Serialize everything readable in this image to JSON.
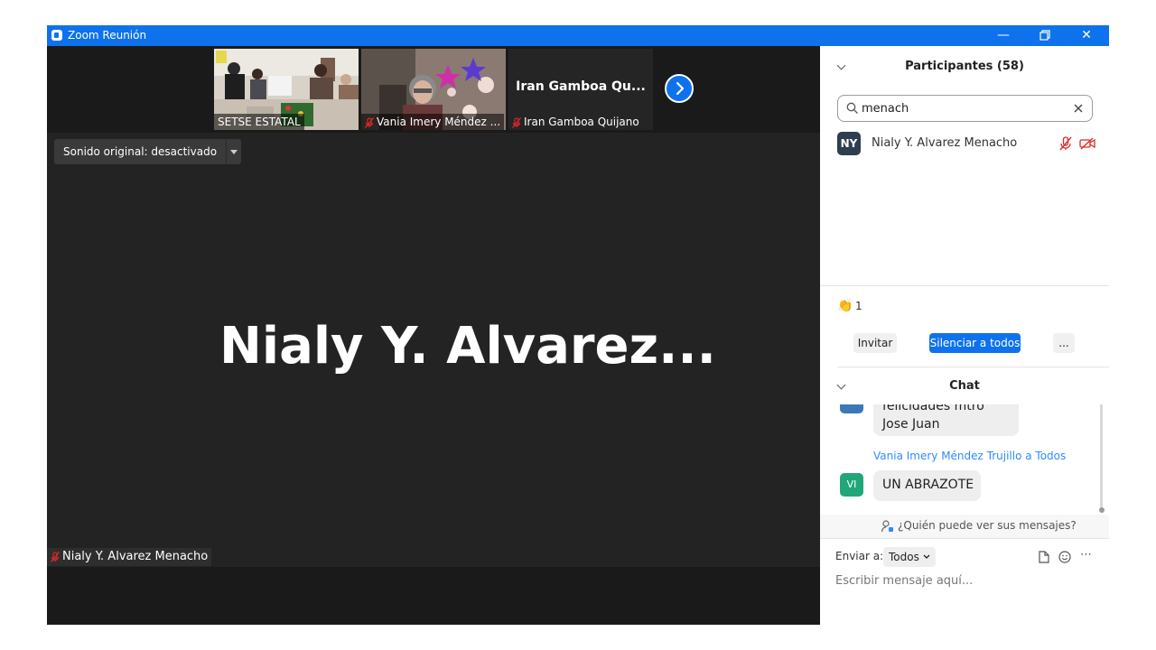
{
  "window": {
    "title": "Zoom Reunión"
  },
  "thumbnails": [
    {
      "label": "SETSE ESTATAL",
      "muted": false
    },
    {
      "label": "Vania Imery Méndez ...",
      "muted": true
    },
    {
      "label": "Iran Gamboa Quijano",
      "muted": true,
      "big_name": "Iran Gamboa Qu..."
    }
  ],
  "original_sound": {
    "label": "Sonido original: desactivado"
  },
  "main_speaker": {
    "big_name": "Nialy  Y.  Alvarez...",
    "name_tag": "Nialy Y. Alvarez Menacho"
  },
  "participants": {
    "header": "Participantes (58)",
    "search_value": "menach",
    "list": [
      {
        "initials": "NY",
        "name": "Nialy Y. Alvarez Menacho"
      }
    ],
    "reaction_count": "1",
    "invite_label": "Invitar",
    "mute_all_label": "Silenciar a todos",
    "more_label": "..."
  },
  "chat": {
    "header": "Chat",
    "partial_message": "felicidades mtro Jose Juan",
    "messages": [
      {
        "sender": "Vania Imery Méndez Trujillo a Todos",
        "initials": "VI",
        "text": "UN ABRAZOTE"
      }
    ],
    "who_can_see": "¿Quién puede ver sus mensajes?",
    "send_to_label": "Enviar a:",
    "send_to_value": "Todos",
    "input_placeholder": "Escribir mensaje aquí..."
  },
  "colors": {
    "accent": "#0e72ed",
    "ny_avatar": "#2d3e50",
    "vi_avatar": "#21a67a"
  }
}
